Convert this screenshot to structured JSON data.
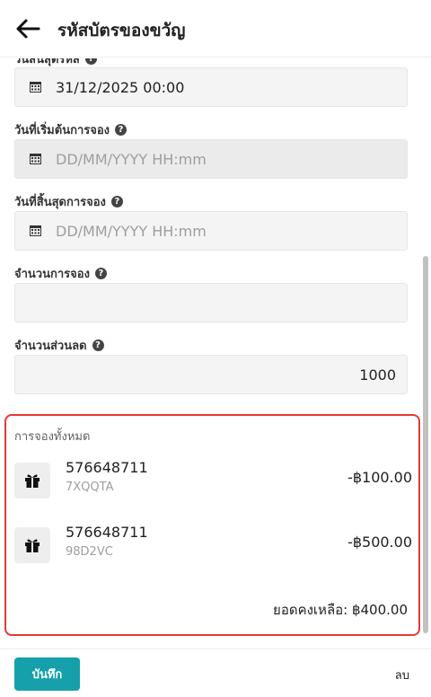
{
  "header": {
    "title": "รหัสบัตรของขวัญ"
  },
  "fields": {
    "expiry": {
      "label": "วันสิ้นสุดรหัส",
      "value": "31/12/2025 00:00"
    },
    "booking_start": {
      "label": "วันที่เริ่มต้นการจอง",
      "placeholder": "DD/MM/YYYY HH:mm"
    },
    "booking_end": {
      "label": "วันที่สิ้นสุดการจอง",
      "placeholder": "DD/MM/YYYY HH:mm"
    },
    "booking_count": {
      "label": "จำนวนการจอง",
      "value": ""
    },
    "discount_count": {
      "label": "จำนวนส่วนลด",
      "value": "1000"
    }
  },
  "bookings": {
    "title": "การจองทั้งหมด",
    "items": [
      {
        "code": "576648711",
        "ref": "7XQQTA",
        "amount": "-฿100.00"
      },
      {
        "code": "576648711",
        "ref": "98D2VC",
        "amount": "-฿500.00"
      }
    ],
    "balance": "ยอดคงเหลือ: ฿400.00"
  },
  "footer": {
    "save_label": "บันทึก",
    "delete_label": "ลบ"
  },
  "colors": {
    "primary": "#16a0ab",
    "highlight_border": "#e53935"
  },
  "icons": {
    "back": "arrow-left-icon",
    "calendar": "calendar-icon",
    "help": "question-circle-icon",
    "gift": "gift-icon"
  }
}
